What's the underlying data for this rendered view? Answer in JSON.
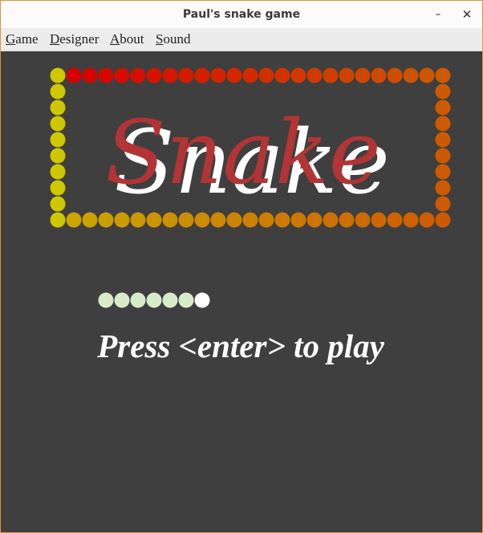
{
  "window": {
    "title": "Paul's snake game"
  },
  "menu": {
    "items": [
      {
        "mnemonic": "G",
        "rest": "ame"
      },
      {
        "mnemonic": "D",
        "rest": "esigner"
      },
      {
        "mnemonic": "A",
        "rest": "bout"
      },
      {
        "mnemonic": "S",
        "rest": "ound"
      }
    ]
  },
  "game": {
    "logo_text": "Snake",
    "prompt": "Press <enter> to play",
    "colors": {
      "background": "#3f3f3f",
      "logo_text": "#b23434",
      "logo_shadow": "#ffffff",
      "border_left": "#cfc800",
      "border_top_start": "#d60000",
      "border_right": "#cd5a00",
      "border_bottom_start": "#cba800",
      "snake_body": "#d8ebc8",
      "snake_head": "#ffffff"
    },
    "snake_length": 7
  }
}
